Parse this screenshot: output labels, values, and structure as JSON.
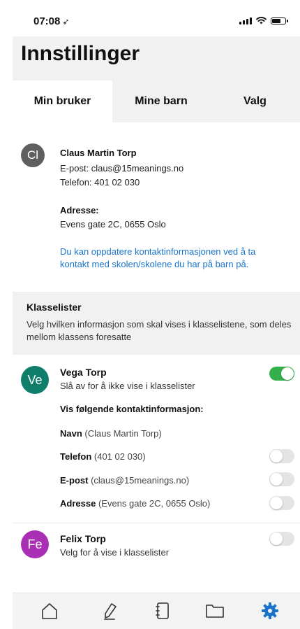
{
  "status_bar": {
    "time": "07:08",
    "location_icon": "location-arrow-icon"
  },
  "header": {
    "title": "Innstillinger"
  },
  "tabs": [
    {
      "label": "Min bruker",
      "active": true
    },
    {
      "label": "Mine barn",
      "active": false
    },
    {
      "label": "Valg",
      "active": false
    }
  ],
  "profile": {
    "initials": "Cl",
    "name": "Claus Martin Torp",
    "email_line": "E-post: claus@15meanings.no",
    "phone_line": "Telefon: 401 02 030",
    "address_label": "Adresse:",
    "address": "Evens gate 2C, 0655 Oslo",
    "info": "Du kan oppdatere kontaktinformasjonen ved å ta kontakt med skolen/skolene du har på barn på."
  },
  "klasselister": {
    "title": "Klasselister",
    "description": "Velg hvilken informasjon som skal vises i klasselistene, som deles mellom klassens foresatte"
  },
  "children": [
    {
      "initials": "Ve",
      "name": "Vega Torp",
      "subtitle": "Slå av for å ikke vise i klasselister",
      "enabled": true,
      "avatar_color": "#0f7e6b",
      "contact_title": "Vis følgende kontaktinformasjon:",
      "contact_rows": [
        {
          "label": "Navn",
          "value": "(Claus Martin Torp)",
          "has_toggle": false
        },
        {
          "label": "Telefon",
          "value": "(401 02 030)",
          "has_toggle": true,
          "enabled": false
        },
        {
          "label": "E-post",
          "value": "(claus@15meanings.no)",
          "has_toggle": true,
          "enabled": false
        },
        {
          "label": "Adresse",
          "value": "(Evens gate 2C, 0655 Oslo)",
          "has_toggle": true,
          "enabled": false
        }
      ]
    },
    {
      "initials": "Fe",
      "name": "Felix Torp",
      "subtitle": "Velg for å vise i klasselister",
      "enabled": false,
      "avatar_color": "#a92fb5"
    }
  ],
  "bottom_nav": [
    {
      "icon": "home-icon"
    },
    {
      "icon": "pen-icon"
    },
    {
      "icon": "notebook-icon"
    },
    {
      "icon": "folder-icon"
    },
    {
      "icon": "gear-icon",
      "active": true
    }
  ],
  "colors": {
    "accent": "#1a73c9",
    "toggle_on": "#33b04a",
    "active_nav": "#1a73c9"
  }
}
